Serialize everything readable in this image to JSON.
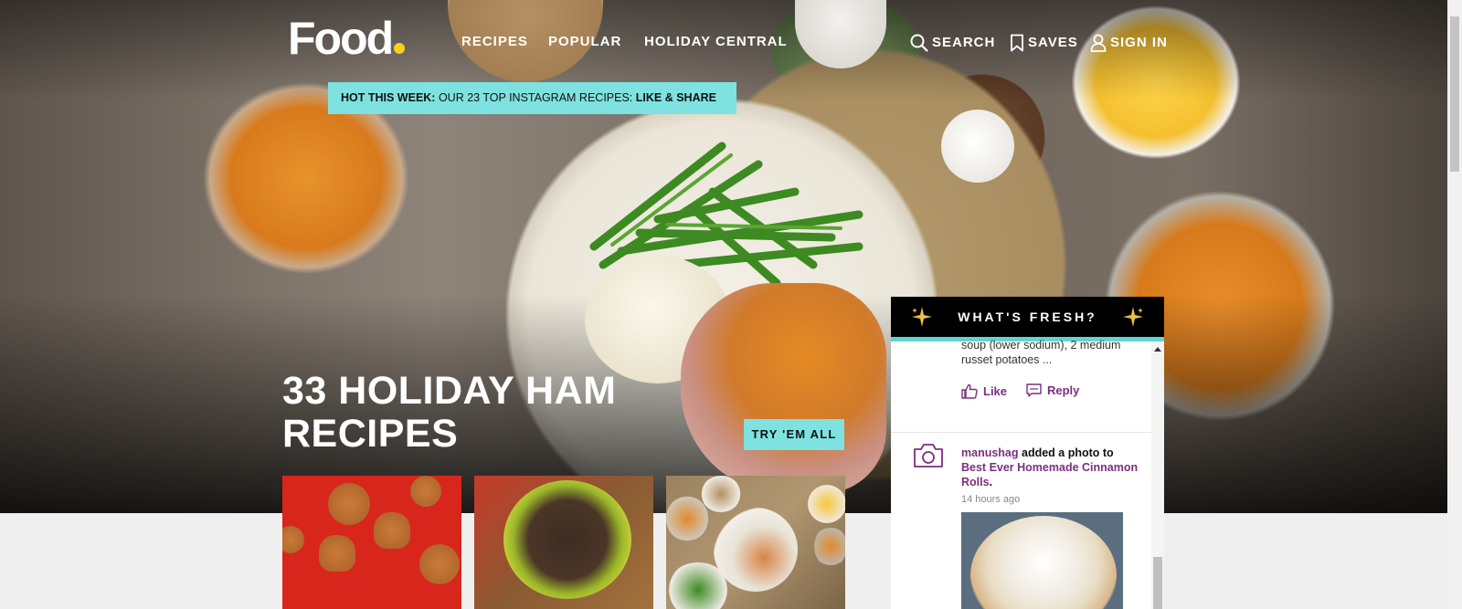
{
  "header": {
    "logo": "Food",
    "nav": [
      "RECIPES",
      "POPULAR",
      "HOLIDAY CENTRAL"
    ],
    "search_label": "SEARCH",
    "saves_label": "SAVES",
    "signin_label": "SIGN IN"
  },
  "banner": {
    "prefix": "HOT THIS WEEK:",
    "text": "OUR 23 TOP INSTAGRAM RECIPES:",
    "cta": "LIKE & SHARE"
  },
  "hero": {
    "title": "33 HOLIDAY HAM RECIPES",
    "button": "TRY 'EM ALL"
  },
  "fresh": {
    "title": "WHAT'S FRESH?",
    "snippet": "soup (lower sodium), 2 medium russet potatoes ...",
    "like_label": "Like",
    "reply_label": "Reply",
    "activity": {
      "user": "manushag",
      "action": "added a photo to",
      "recipe": "Best Ever Homemade Cinnamon Rolls",
      "end": ".",
      "time": "14 hours ago"
    }
  },
  "colors": {
    "accent": "#7ee2e0",
    "brand_purple": "#7a2f7e",
    "logo_dot": "#f5d21e"
  },
  "icons": [
    "search-icon",
    "bookmark-icon",
    "user-icon",
    "sparkle-icon",
    "like-icon",
    "reply-icon",
    "camera-icon"
  ]
}
